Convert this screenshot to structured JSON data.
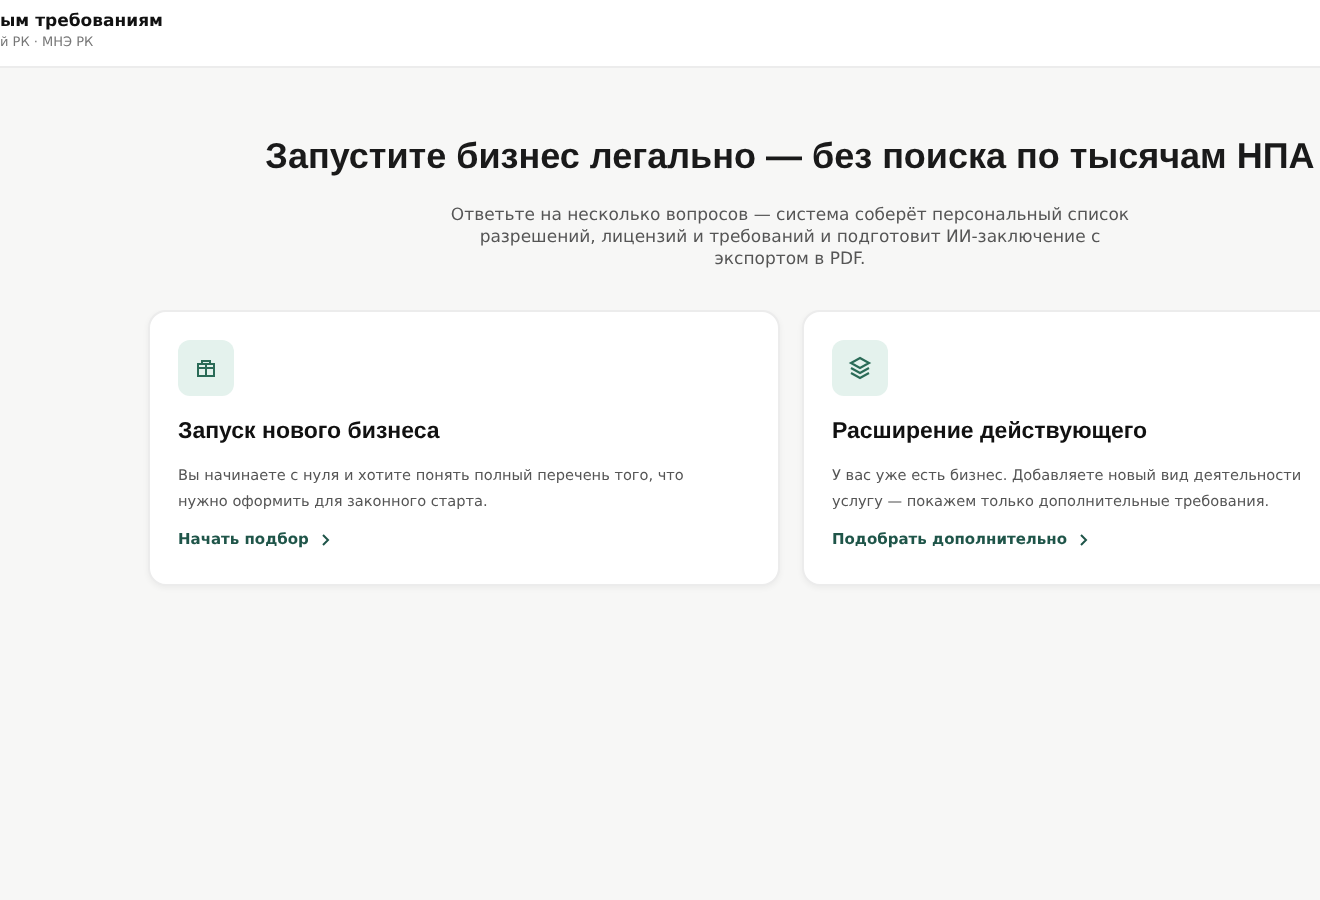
{
  "header": {
    "title": "ым требованиям",
    "subtitle": "й РК · МНЭ РК"
  },
  "hero": {
    "title": "Запустите бизнес легально — без поиска по тысячам НПА",
    "description": "Ответьте на несколько вопросов — система соберёт персональный список разрешений, лицензий и требований и подготовит ИИ-заключение с экспортом в PDF."
  },
  "cards": [
    {
      "kind": "gift",
      "title": "Запуск нового бизнеса",
      "description": "Вы начинаете с нуля и хотите понять полный перечень того, что нужно оформить для законного старта.",
      "link": "Начать подбор"
    },
    {
      "kind": "layers",
      "title": "Расширение действующего",
      "description": "У вас уже есть бизнес. Добавляете новый вид деятельности услугу — покажем только дополнительные требования.",
      "link": "Подобрать дополнительно"
    }
  ]
}
